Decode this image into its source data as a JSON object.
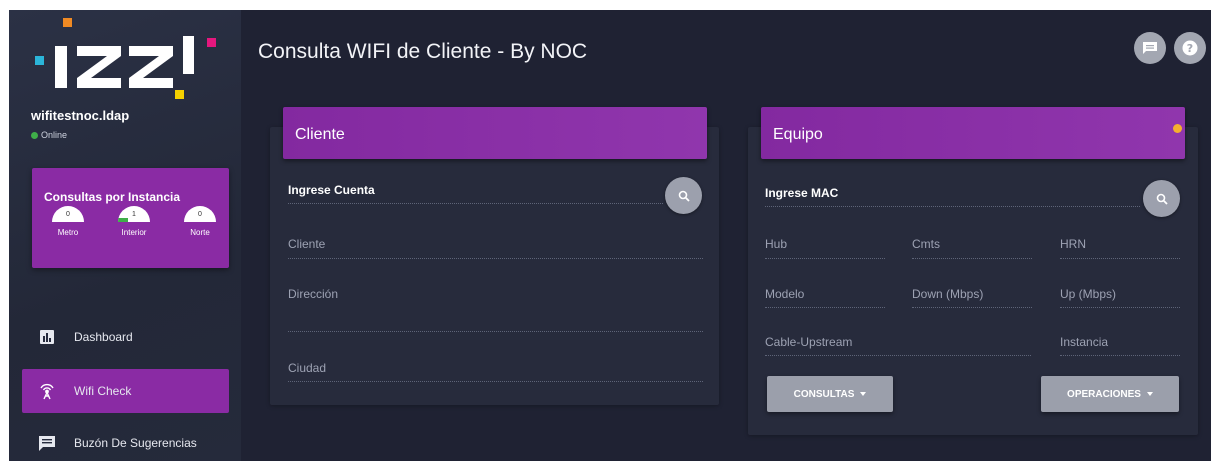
{
  "app": {
    "logo_text": ".IZZI",
    "user": {
      "name": "wifitestnoc.ldap",
      "status": "Online"
    }
  },
  "instancias": {
    "title": "Consultas por Instancia",
    "gauges": [
      {
        "label": "Metro",
        "value": "0"
      },
      {
        "label": "Interior",
        "value": "1"
      },
      {
        "label": "Norte",
        "value": "0"
      }
    ]
  },
  "nav": [
    {
      "label": "Dashboard",
      "icon": "bar-chart-icon"
    },
    {
      "label": "Wifi Check",
      "icon": "wifi-antenna-icon",
      "active": true
    },
    {
      "label": "Buzón De Sugerencias",
      "icon": "message-icon"
    }
  ],
  "header": {
    "title": "Consulta WIFI de Cliente - By NOC"
  },
  "cliente": {
    "title": "Cliente",
    "cuenta_label": "Ingrese Cuenta",
    "fields": {
      "cliente": "Cliente",
      "direccion": "Dirección",
      "ciudad": "Ciudad"
    }
  },
  "equipo": {
    "title": "Equipo",
    "mac_label": "Ingrese MAC",
    "fields": {
      "hub": "Hub",
      "cmts": "Cmts",
      "hrn": "HRN",
      "modelo": "Modelo",
      "down": "Down (Mbps)",
      "up": "Up (Mbps)",
      "cable_upstream": "Cable-Upstream",
      "instancia": "Instancia"
    },
    "buttons": {
      "consultas": "CONSULTAS",
      "operaciones": "OPERACIONES"
    }
  },
  "colors": {
    "accent": "#8a2ba4",
    "background": "#1f2233",
    "card": "#272b3c",
    "status_dot": "#f5b02e"
  }
}
